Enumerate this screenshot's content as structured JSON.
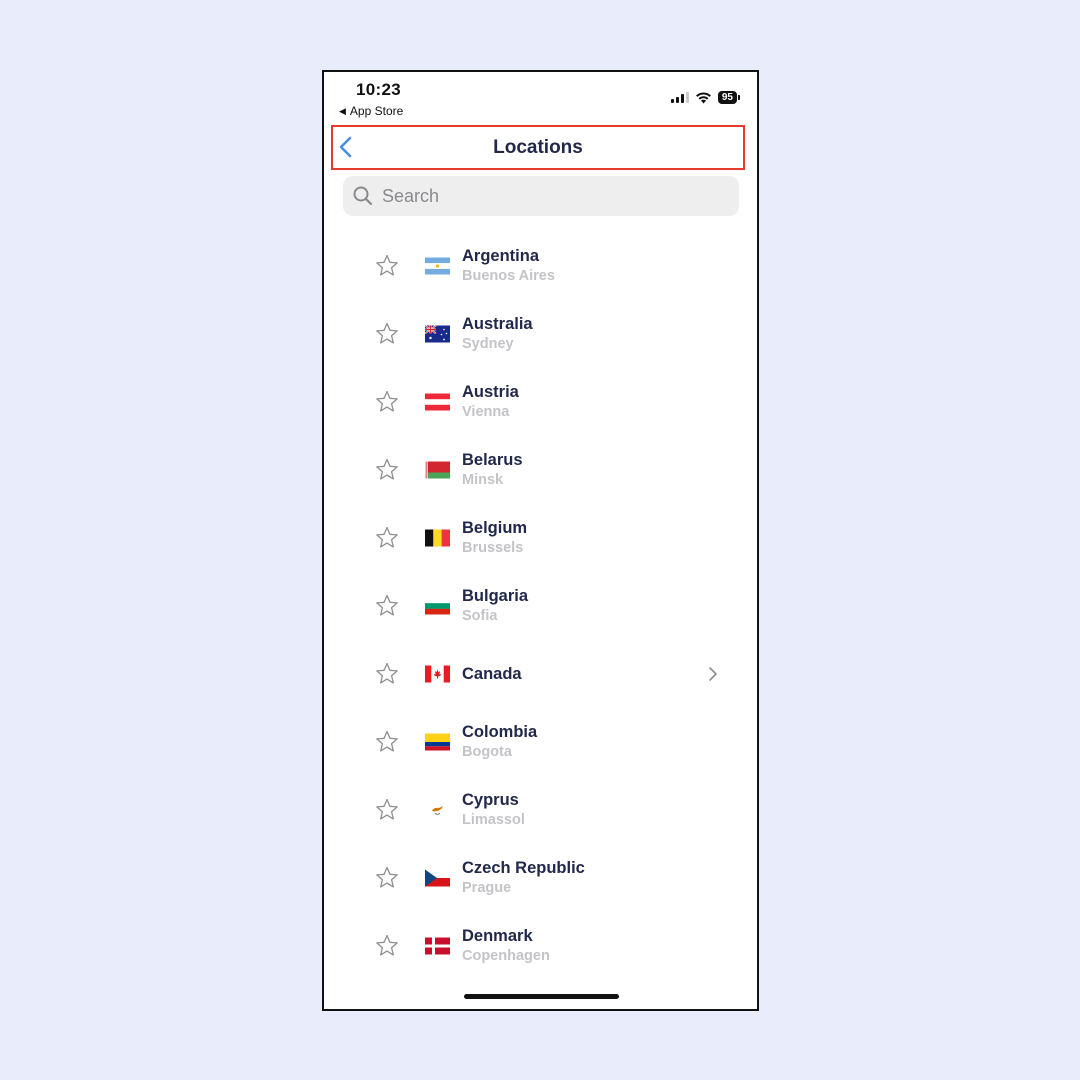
{
  "status_bar": {
    "time": "10:23",
    "back_app_label": "App Store",
    "battery": "95"
  },
  "header": {
    "title": "Locations",
    "back_icon": "chevron-left-icon",
    "accent_color": "#4a8de8",
    "highlight_color": "#e53a2e"
  },
  "search": {
    "placeholder": "Search",
    "value": ""
  },
  "locations": [
    {
      "country": "Argentina",
      "city": "Buenos Aires",
      "flag": "argentina",
      "favorite": false
    },
    {
      "country": "Australia",
      "city": "Sydney",
      "flag": "australia",
      "favorite": false
    },
    {
      "country": "Austria",
      "city": "Vienna",
      "flag": "austria",
      "favorite": false
    },
    {
      "country": "Belarus",
      "city": "Minsk",
      "flag": "belarus",
      "favorite": false
    },
    {
      "country": "Belgium",
      "city": "Brussels",
      "flag": "belgium",
      "favorite": false
    },
    {
      "country": "Bulgaria",
      "city": "Sofia",
      "flag": "bulgaria",
      "favorite": false
    },
    {
      "country": "Canada",
      "city": "",
      "flag": "canada",
      "favorite": false,
      "expandable": true
    },
    {
      "country": "Colombia",
      "city": "Bogota",
      "flag": "colombia",
      "favorite": false
    },
    {
      "country": "Cyprus",
      "city": "Limassol",
      "flag": "cyprus",
      "favorite": false
    },
    {
      "country": "Czech Republic",
      "city": "Prague",
      "flag": "czech-republic",
      "favorite": false
    },
    {
      "country": "Denmark",
      "city": "Copenhagen",
      "flag": "denmark",
      "favorite": false
    }
  ]
}
